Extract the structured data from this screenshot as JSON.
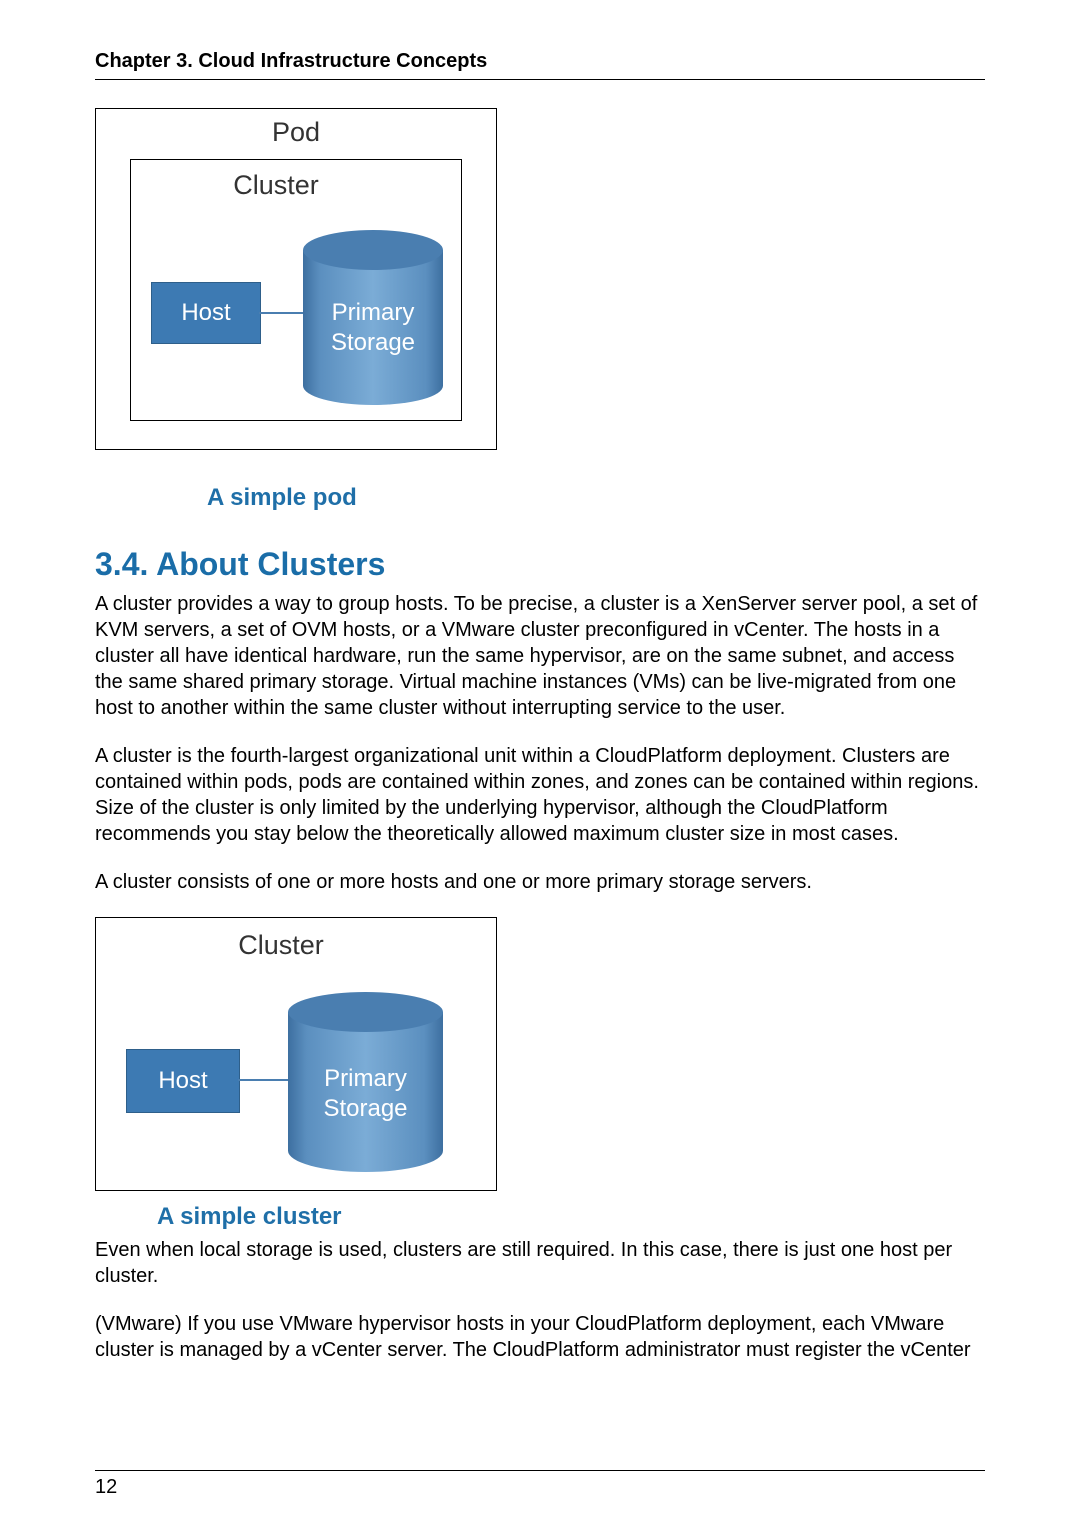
{
  "header": {
    "chapter": "Chapter 3. Cloud Infrastructure Concepts"
  },
  "figure_pod": {
    "title": "Pod",
    "cluster_title": "Cluster",
    "host_label": "Host",
    "storage_line1": "Primary",
    "storage_line2": "Storage",
    "caption": "A simple pod"
  },
  "section": {
    "heading": "3.4. About Clusters",
    "para1": "A cluster provides a way to group hosts. To be precise, a cluster is a XenServer server pool, a set of KVM servers, a set of OVM hosts, or a VMware cluster preconfigured in vCenter. The hosts in a cluster all have identical hardware, run the same hypervisor, are on the same subnet, and access the same shared primary storage. Virtual machine instances (VMs) can be live-migrated from one host to another within the same cluster without interrupting service to the user.",
    "para2": "A cluster is the fourth-largest organizational unit within a CloudPlatform deployment. Clusters are contained within pods, pods are contained within zones, and zones can be contained within regions. Size of the cluster is only limited by the underlying hypervisor, although the CloudPlatform recommends you stay below the theoretically allowed maximum cluster size in most cases.",
    "para3": "A cluster consists of one or more hosts and one or more primary storage servers."
  },
  "figure_cluster": {
    "cluster_title": "Cluster",
    "host_label": "Host",
    "storage_line1": "Primary",
    "storage_line2": "Storage",
    "caption": "A simple cluster"
  },
  "trailing": {
    "para4": "Even when local storage is used, clusters are still required. In this case, there is just one host per cluster.",
    "para5": "(VMware) If you use VMware hypervisor hosts in your CloudPlatform deployment, each VMware cluster is managed by a vCenter server. The CloudPlatform administrator must register the vCenter"
  },
  "footer": {
    "page_number": "12"
  }
}
